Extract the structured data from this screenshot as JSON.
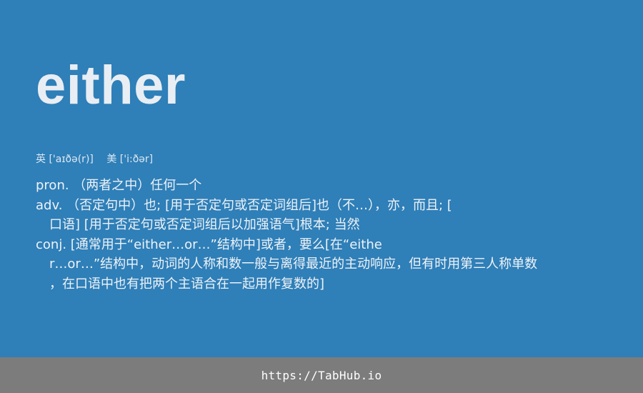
{
  "word": "either",
  "phonetics": {
    "uk_label": "英",
    "uk": "['aɪðə(r)]",
    "us_label": "美",
    "us": "['i:ðər]"
  },
  "definitions": [
    "pron. （两者之中）任何一个",
    "adv. （否定句中）也; [用于否定句或否定词组后]也（不…），亦，而且; [",
    "口语] [用于否定句或否定词组后以加强语气]根本; 当然",
    "conj. [通常用于“either…or…”结构中]或者，要么[在“eithe",
    "r…or…”结构中，动词的人称和数一般与离得最近的主动响应，但有时用第三人称单数",
    "，在口语中也有把两个主语合在一起用作复数的]"
  ],
  "footer": {
    "url": "https://TabHub.io"
  },
  "colors": {
    "background": "#2f7fb8",
    "footer": "#7c7c7c",
    "word": "#e8eef3"
  }
}
